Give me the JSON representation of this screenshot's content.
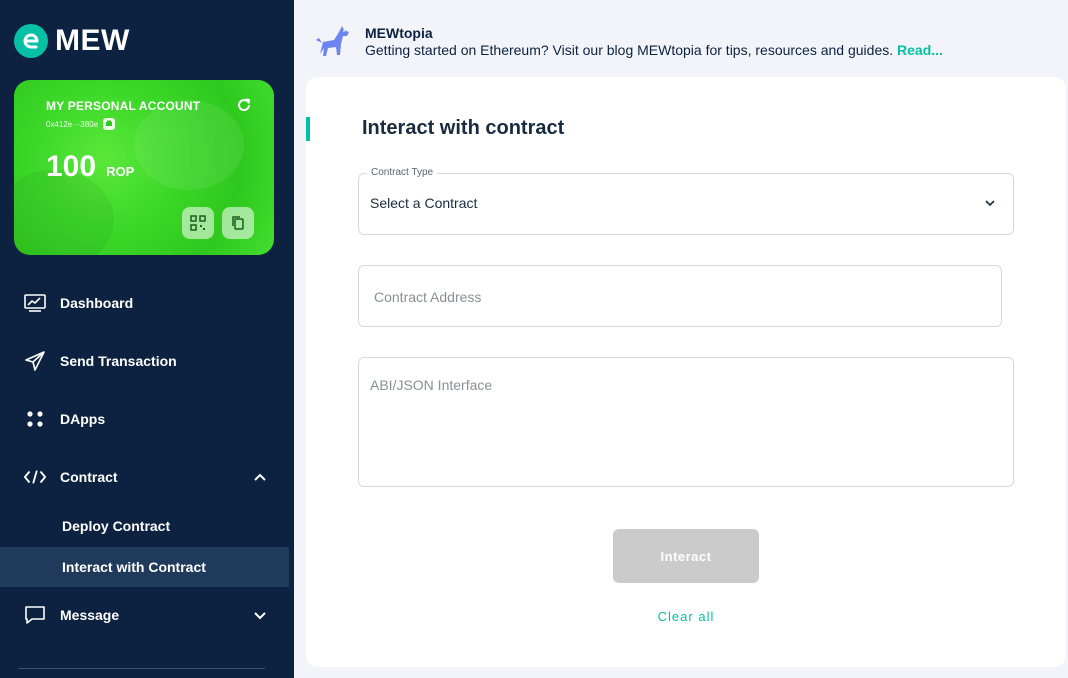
{
  "app": {
    "logo_text": "MEW",
    "accent_color": "#05c0a5",
    "sidebar_color": "#0c2240"
  },
  "account_card": {
    "title": "MY PERSONAL ACCOUNT",
    "address": "0x412e···380e",
    "balance": "100",
    "unit": "ROP",
    "card_color": "#3dd82a"
  },
  "sidebar": {
    "items": [
      {
        "label": "Dashboard",
        "icon": "chart-monitor-icon"
      },
      {
        "label": "Send Transaction",
        "icon": "paper-plane-icon"
      },
      {
        "label": "DApps",
        "icon": "dots-grid-icon"
      },
      {
        "label": "Contract",
        "icon": "code-icon",
        "expanded": true
      },
      {
        "label": "Message",
        "icon": "message-icon",
        "expanded": false
      }
    ],
    "contract_sub": [
      {
        "label": "Deploy Contract",
        "active": false
      },
      {
        "label": "Interact with Contract",
        "active": true
      }
    ]
  },
  "banner": {
    "title": "MEWtopia",
    "description": "Getting started on Ethereum? Visit our blog MEWtopia for tips, resources and guides.",
    "link": "Read..."
  },
  "main": {
    "title": "Interact with contract",
    "contract_type": {
      "label": "Contract Type",
      "value": "Select a Contract"
    },
    "contract_address": {
      "placeholder": "Contract Address"
    },
    "abi": {
      "placeholder": "ABI/JSON Interface"
    },
    "interact_button": "Interact",
    "clear_link": "Clear all"
  }
}
